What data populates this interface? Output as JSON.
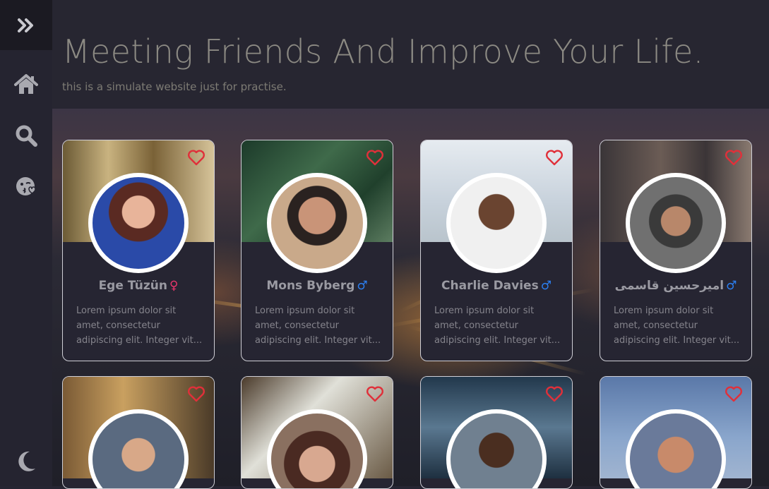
{
  "sidebar": {
    "items": [
      {
        "icon": "expand-chevrons-icon"
      },
      {
        "icon": "home-icon"
      },
      {
        "icon": "search-icon"
      },
      {
        "icon": "kiss-emoji-icon"
      },
      {
        "icon": "moon-icon"
      }
    ]
  },
  "header": {
    "title": "Meeting Friends And Improve Your Life.",
    "subtitle": "this is a simulate website just for practise."
  },
  "colors": {
    "female": "#e8366b",
    "male": "#2c7ff0",
    "heart": "#e0303a"
  },
  "cards": [
    {
      "name": "Ege Tüzün",
      "gender": "female",
      "gender_symbol": "♀",
      "desc_lines": [
        "Lorem ipsum dolor sit",
        "amet, consectetur",
        "adipiscing elit. Integer vit..."
      ]
    },
    {
      "name": "Mons Byberg",
      "gender": "male",
      "gender_symbol": "♂",
      "desc_lines": [
        "Lorem ipsum dolor sit",
        "amet, consectetur",
        "adipiscing elit. Integer vit..."
      ]
    },
    {
      "name": "Charlie Davies",
      "gender": "male",
      "gender_symbol": "♂",
      "desc_lines": [
        "Lorem ipsum dolor sit",
        "amet, consectetur",
        "adipiscing elit. Integer vit..."
      ]
    },
    {
      "name": "امیرحسین قاسمی",
      "gender": "male",
      "gender_symbol": "♂",
      "desc_lines": [
        "Lorem ipsum dolor sit",
        "amet, consectetur",
        "adipiscing elit. Integer vit..."
      ]
    },
    {
      "name": "",
      "gender": "",
      "gender_symbol": "",
      "desc_lines": []
    },
    {
      "name": "",
      "gender": "",
      "gender_symbol": "",
      "desc_lines": []
    },
    {
      "name": "",
      "gender": "",
      "gender_symbol": "",
      "desc_lines": []
    },
    {
      "name": "",
      "gender": "",
      "gender_symbol": "",
      "desc_lines": []
    }
  ]
}
